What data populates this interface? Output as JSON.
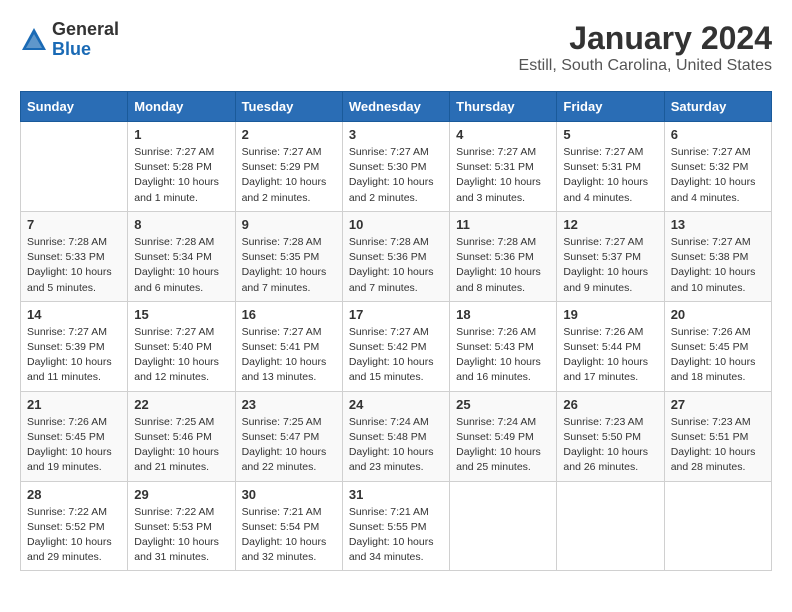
{
  "logo": {
    "general": "General",
    "blue": "Blue"
  },
  "title": "January 2024",
  "subtitle": "Estill, South Carolina, United States",
  "weekdays": [
    "Sunday",
    "Monday",
    "Tuesday",
    "Wednesday",
    "Thursday",
    "Friday",
    "Saturday"
  ],
  "weeks": [
    [
      {
        "day": "",
        "info": ""
      },
      {
        "day": "1",
        "info": "Sunrise: 7:27 AM\nSunset: 5:28 PM\nDaylight: 10 hours\nand 1 minute."
      },
      {
        "day": "2",
        "info": "Sunrise: 7:27 AM\nSunset: 5:29 PM\nDaylight: 10 hours\nand 2 minutes."
      },
      {
        "day": "3",
        "info": "Sunrise: 7:27 AM\nSunset: 5:30 PM\nDaylight: 10 hours\nand 2 minutes."
      },
      {
        "day": "4",
        "info": "Sunrise: 7:27 AM\nSunset: 5:31 PM\nDaylight: 10 hours\nand 3 minutes."
      },
      {
        "day": "5",
        "info": "Sunrise: 7:27 AM\nSunset: 5:31 PM\nDaylight: 10 hours\nand 4 minutes."
      },
      {
        "day": "6",
        "info": "Sunrise: 7:27 AM\nSunset: 5:32 PM\nDaylight: 10 hours\nand 4 minutes."
      }
    ],
    [
      {
        "day": "7",
        "info": "Sunrise: 7:28 AM\nSunset: 5:33 PM\nDaylight: 10 hours\nand 5 minutes."
      },
      {
        "day": "8",
        "info": "Sunrise: 7:28 AM\nSunset: 5:34 PM\nDaylight: 10 hours\nand 6 minutes."
      },
      {
        "day": "9",
        "info": "Sunrise: 7:28 AM\nSunset: 5:35 PM\nDaylight: 10 hours\nand 7 minutes."
      },
      {
        "day": "10",
        "info": "Sunrise: 7:28 AM\nSunset: 5:36 PM\nDaylight: 10 hours\nand 7 minutes."
      },
      {
        "day": "11",
        "info": "Sunrise: 7:28 AM\nSunset: 5:36 PM\nDaylight: 10 hours\nand 8 minutes."
      },
      {
        "day": "12",
        "info": "Sunrise: 7:27 AM\nSunset: 5:37 PM\nDaylight: 10 hours\nand 9 minutes."
      },
      {
        "day": "13",
        "info": "Sunrise: 7:27 AM\nSunset: 5:38 PM\nDaylight: 10 hours\nand 10 minutes."
      }
    ],
    [
      {
        "day": "14",
        "info": "Sunrise: 7:27 AM\nSunset: 5:39 PM\nDaylight: 10 hours\nand 11 minutes."
      },
      {
        "day": "15",
        "info": "Sunrise: 7:27 AM\nSunset: 5:40 PM\nDaylight: 10 hours\nand 12 minutes."
      },
      {
        "day": "16",
        "info": "Sunrise: 7:27 AM\nSunset: 5:41 PM\nDaylight: 10 hours\nand 13 minutes."
      },
      {
        "day": "17",
        "info": "Sunrise: 7:27 AM\nSunset: 5:42 PM\nDaylight: 10 hours\nand 15 minutes."
      },
      {
        "day": "18",
        "info": "Sunrise: 7:26 AM\nSunset: 5:43 PM\nDaylight: 10 hours\nand 16 minutes."
      },
      {
        "day": "19",
        "info": "Sunrise: 7:26 AM\nSunset: 5:44 PM\nDaylight: 10 hours\nand 17 minutes."
      },
      {
        "day": "20",
        "info": "Sunrise: 7:26 AM\nSunset: 5:45 PM\nDaylight: 10 hours\nand 18 minutes."
      }
    ],
    [
      {
        "day": "21",
        "info": "Sunrise: 7:26 AM\nSunset: 5:45 PM\nDaylight: 10 hours\nand 19 minutes."
      },
      {
        "day": "22",
        "info": "Sunrise: 7:25 AM\nSunset: 5:46 PM\nDaylight: 10 hours\nand 21 minutes."
      },
      {
        "day": "23",
        "info": "Sunrise: 7:25 AM\nSunset: 5:47 PM\nDaylight: 10 hours\nand 22 minutes."
      },
      {
        "day": "24",
        "info": "Sunrise: 7:24 AM\nSunset: 5:48 PM\nDaylight: 10 hours\nand 23 minutes."
      },
      {
        "day": "25",
        "info": "Sunrise: 7:24 AM\nSunset: 5:49 PM\nDaylight: 10 hours\nand 25 minutes."
      },
      {
        "day": "26",
        "info": "Sunrise: 7:23 AM\nSunset: 5:50 PM\nDaylight: 10 hours\nand 26 minutes."
      },
      {
        "day": "27",
        "info": "Sunrise: 7:23 AM\nSunset: 5:51 PM\nDaylight: 10 hours\nand 28 minutes."
      }
    ],
    [
      {
        "day": "28",
        "info": "Sunrise: 7:22 AM\nSunset: 5:52 PM\nDaylight: 10 hours\nand 29 minutes."
      },
      {
        "day": "29",
        "info": "Sunrise: 7:22 AM\nSunset: 5:53 PM\nDaylight: 10 hours\nand 31 minutes."
      },
      {
        "day": "30",
        "info": "Sunrise: 7:21 AM\nSunset: 5:54 PM\nDaylight: 10 hours\nand 32 minutes."
      },
      {
        "day": "31",
        "info": "Sunrise: 7:21 AM\nSunset: 5:55 PM\nDaylight: 10 hours\nand 34 minutes."
      },
      {
        "day": "",
        "info": ""
      },
      {
        "day": "",
        "info": ""
      },
      {
        "day": "",
        "info": ""
      }
    ]
  ]
}
